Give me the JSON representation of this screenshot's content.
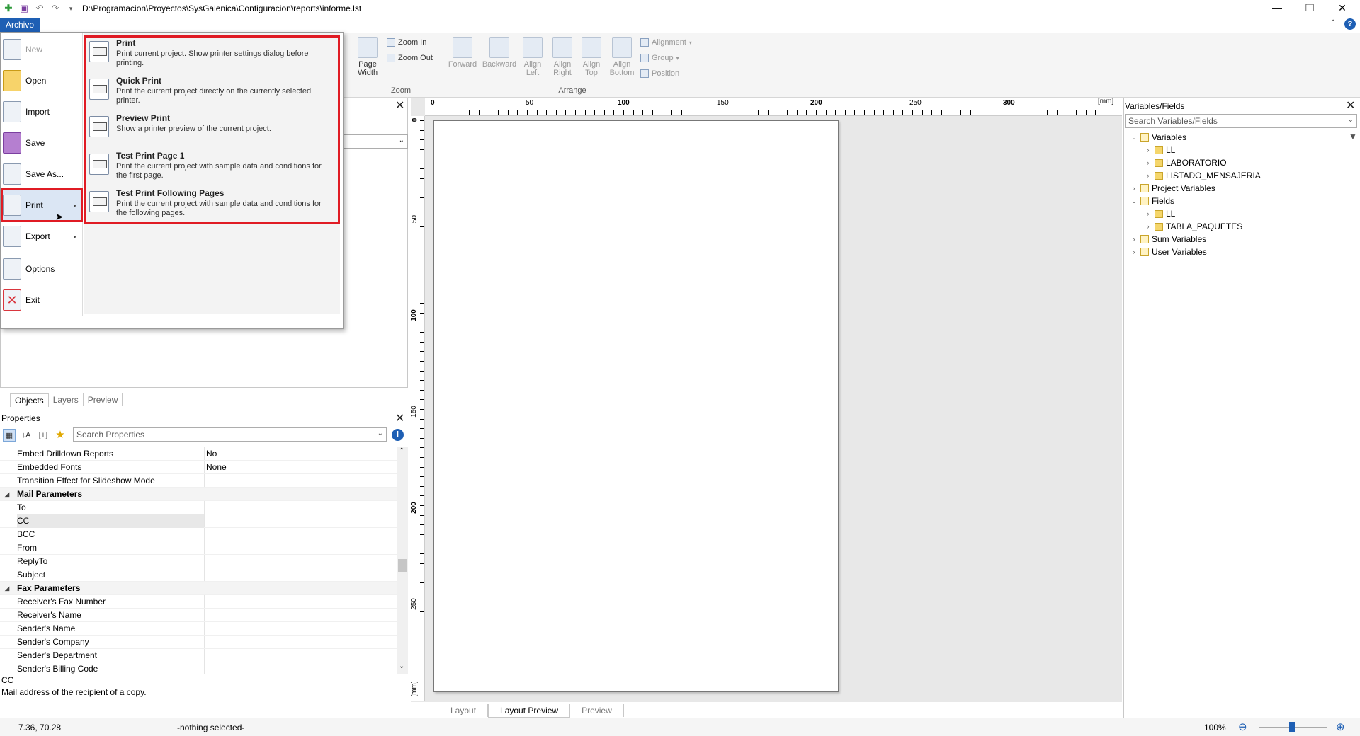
{
  "window": {
    "title": "D:\\Programacion\\Proyectos\\SysGalenica\\Configuracion\\reports\\informe.lst",
    "min": "—",
    "restore": "❐",
    "close": "✕"
  },
  "ribbon": {
    "archivo_tab": "Archivo",
    "page_width": "Page Width",
    "zoom_in": "Zoom In",
    "zoom_out": "Zoom Out",
    "zoom_group": "Zoom",
    "forward": "Forward",
    "backward": "Backward",
    "align_left": "Align Left",
    "align_right": "Align Right",
    "align_top": "Align Top",
    "align_bottom": "Align Bottom",
    "alignment": "Alignment",
    "group": "Group",
    "position": "Position",
    "arrange_group": "Arrange"
  },
  "backstage": {
    "items": [
      {
        "label": "New"
      },
      {
        "label": "Open"
      },
      {
        "label": "Import"
      },
      {
        "label": "Save"
      },
      {
        "label": "Save As..."
      },
      {
        "label": "Print"
      },
      {
        "label": "Export"
      },
      {
        "label": "Options"
      },
      {
        "label": "Exit"
      }
    ],
    "print_submenu": [
      {
        "title": "Print",
        "desc": "Print current project. Show printer settings dialog before printing."
      },
      {
        "title": "Quick Print",
        "desc": "Print the current project directly on the currently selected printer."
      },
      {
        "title": "Preview Print",
        "desc": "Show a printer preview of the current project."
      },
      {
        "title": "Test Print Page 1",
        "desc": "Print the current project with sample data and conditions for the first page."
      },
      {
        "title": "Test Print Following Pages",
        "desc": "Print the current project with sample data and conditions for the following pages."
      }
    ]
  },
  "objects_panel": {
    "tabs": [
      "Objects",
      "Layers",
      "Preview"
    ]
  },
  "properties": {
    "title": "Properties",
    "search_placeholder": "Search Properties",
    "rows": [
      {
        "name": "Embed Drilldown Reports",
        "value": "No"
      },
      {
        "name": "Embedded Fonts",
        "value": "None"
      },
      {
        "name": "Transition Effect for Slideshow Mode",
        "value": ""
      },
      {
        "name": "Mail Parameters",
        "value": "",
        "category": true
      },
      {
        "name": "To",
        "value": ""
      },
      {
        "name": "CC",
        "value": ""
      },
      {
        "name": "BCC",
        "value": ""
      },
      {
        "name": "From",
        "value": ""
      },
      {
        "name": "ReplyTo",
        "value": ""
      },
      {
        "name": "Subject",
        "value": ""
      },
      {
        "name": "Fax Parameters",
        "value": "",
        "category": true
      },
      {
        "name": "Receiver's Fax Number",
        "value": ""
      },
      {
        "name": "Receiver's Name",
        "value": ""
      },
      {
        "name": "Sender's Name",
        "value": ""
      },
      {
        "name": "Sender's Company",
        "value": ""
      },
      {
        "name": "Sender's Department",
        "value": ""
      },
      {
        "name": "Sender's Billing Code",
        "value": ""
      }
    ],
    "desc_title": "CC",
    "desc_text": "Mail address of the recipient of a copy."
  },
  "ruler": {
    "unit": "[mm]",
    "top_labels": [
      "0",
      "50",
      "100",
      "150",
      "200",
      "250",
      "300"
    ],
    "left_labels": [
      "0",
      "50",
      "100",
      "150",
      "200",
      "250"
    ]
  },
  "center_tabs": [
    "Layout",
    "Layout Preview",
    "Preview"
  ],
  "variables": {
    "title": "Variables/Fields",
    "search_placeholder": "Search Variables/Fields",
    "tree": [
      {
        "label": "Variables",
        "level": 0,
        "exp": "⌄"
      },
      {
        "label": "LL",
        "level": 1,
        "exp": "›"
      },
      {
        "label": "LABORATORIO",
        "level": 1,
        "exp": "›"
      },
      {
        "label": "LISTADO_MENSAJERIA",
        "level": 1,
        "exp": "›"
      },
      {
        "label": "Project Variables",
        "level": 0,
        "exp": "›"
      },
      {
        "label": "Fields",
        "level": 0,
        "exp": "⌄"
      },
      {
        "label": "LL",
        "level": 1,
        "exp": "›"
      },
      {
        "label": "TABLA_PAQUETES",
        "level": 1,
        "exp": "›"
      },
      {
        "label": "Sum Variables",
        "level": 0,
        "exp": "›"
      },
      {
        "label": "User Variables",
        "level": 0,
        "exp": "›"
      }
    ]
  },
  "status": {
    "coords": "7.36, 70.28",
    "selection": "-nothing selected-",
    "zoom": "100%"
  }
}
